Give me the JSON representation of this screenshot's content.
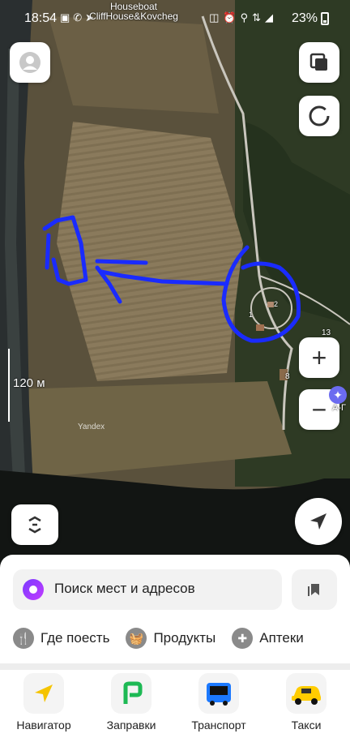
{
  "status_bar": {
    "time": "18:54",
    "battery": "23%"
  },
  "map": {
    "poi_label": "Houseboat CliffHouse&Kovcheg",
    "scale_label": "120 м",
    "watermark": "Yandex",
    "road_numbers": [
      "13",
      "8"
    ],
    "building_numbers": [
      "1",
      "2"
    ],
    "offscreen_label": "А-Г",
    "layers_button_icon": "layers-icon",
    "compass_button_icon": "compass-icon",
    "zoom_in_label": "+",
    "zoom_out_label": "−",
    "rotate_button_icon": "rotate-icon",
    "locate_button_icon": "navigation-arrow-icon",
    "annotation_color": "#1a2bff"
  },
  "search": {
    "placeholder": "Поиск мест и адресов",
    "bookmarks_icon": "bookmarks-icon"
  },
  "chips": [
    {
      "label": "Где поесть",
      "icon": "fork-knife-icon"
    },
    {
      "label": "Продукты",
      "icon": "basket-icon"
    },
    {
      "label": "Аптеки",
      "icon": "pharmacy-cross-icon"
    }
  ],
  "services": [
    {
      "label": "Навигатор",
      "icon": "navigator-icon",
      "color": "#f5c400"
    },
    {
      "label": "Заправки",
      "icon": "fuel-icon",
      "color": "#1db954"
    },
    {
      "label": "Транспорт",
      "icon": "bus-icon",
      "color": "#1c79ff"
    },
    {
      "label": "Такси",
      "icon": "taxi-icon",
      "color": "#ffcc00"
    }
  ]
}
